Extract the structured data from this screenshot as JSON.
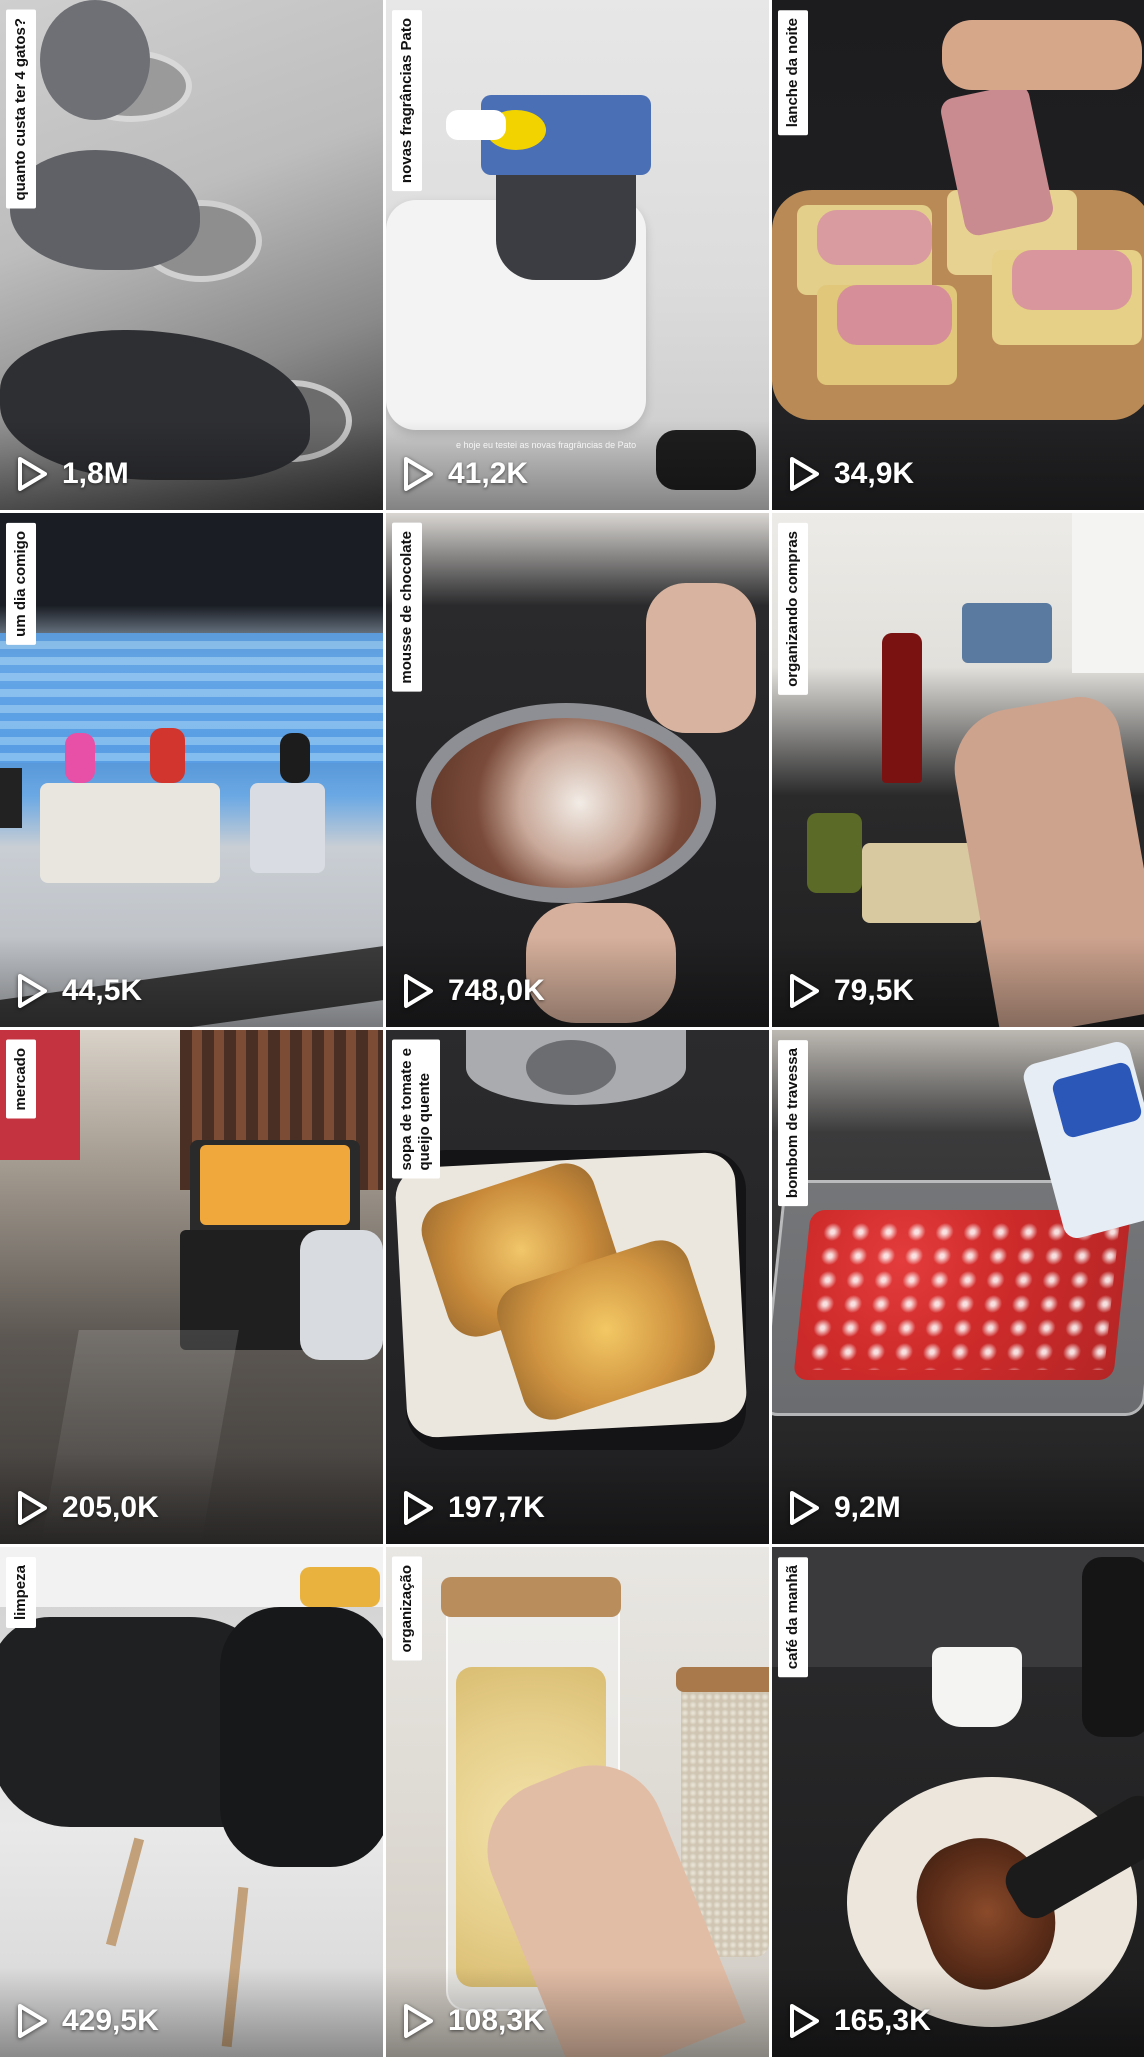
{
  "tiles": [
    {
      "title": "quanto custa ter 4 gatos?",
      "views": "1,8M"
    },
    {
      "title": "novas fragrâncias Pato",
      "views": "41,2K",
      "caption": "e hoje eu testei as novas fragrâncias de Pato"
    },
    {
      "title": "lanche da noite",
      "views": "34,9K"
    },
    {
      "title": "um dia comigo",
      "views": "44,5K"
    },
    {
      "title": "mousse de chocolate",
      "views": "748,0K"
    },
    {
      "title": "organizando compras",
      "views": "79,5K"
    },
    {
      "title": "mercado",
      "views": "205,0K"
    },
    {
      "title": "sopa de tomate e\nqueijo quente",
      "views": "197,7K"
    },
    {
      "title": "bombom de travessa",
      "views": "9,2M"
    },
    {
      "title": "limpeza",
      "views": "429,5K"
    },
    {
      "title": "organização",
      "views": "108,3K"
    },
    {
      "title": "café da manhã",
      "views": "165,3K"
    }
  ],
  "icons": {
    "views": "play-icon"
  }
}
